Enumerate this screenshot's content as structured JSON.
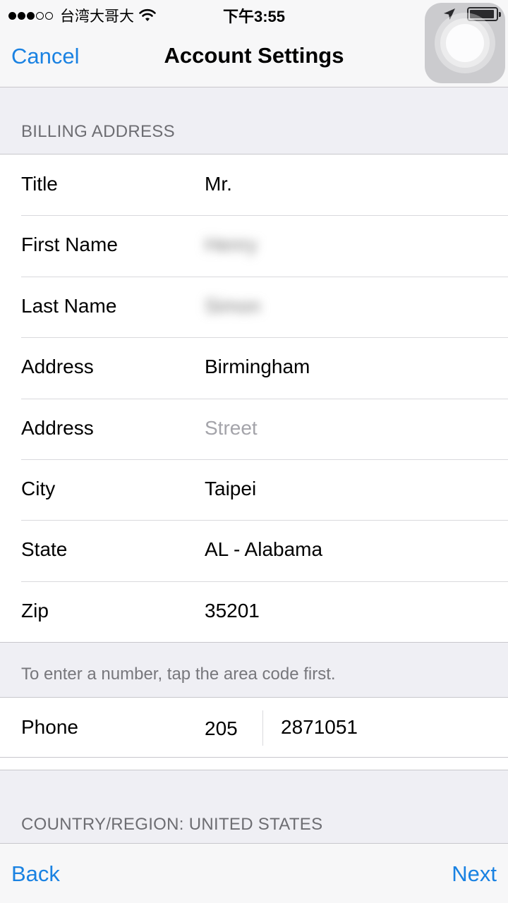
{
  "status_bar": {
    "carrier": "台湾大哥大",
    "time": "下午3:55",
    "signal_icon": "signal-dots-icon",
    "wifi_icon": "wifi-icon",
    "location_icon": "location-arrow-icon",
    "battery_icon": "battery-icon",
    "battery_level": 0.95
  },
  "nav": {
    "cancel_label": "Cancel",
    "title": "Account Settings"
  },
  "billing": {
    "header": "BILLING ADDRESS",
    "rows": [
      {
        "label": "Title",
        "value": "Mr."
      },
      {
        "label": "First Name",
        "value": "Henry"
      },
      {
        "label": "Last Name",
        "value": "Simon"
      },
      {
        "label": "Address",
        "value": "Birmingham"
      },
      {
        "label": "Address",
        "placeholder": "Street"
      },
      {
        "label": "City",
        "value": "Taipei"
      },
      {
        "label": "State",
        "value": "AL - Alabama"
      },
      {
        "label": "Zip",
        "value": "35201"
      }
    ],
    "footer": "To enter a number, tap the area code first."
  },
  "phone": {
    "label": "Phone",
    "area_code": "205",
    "number": "2871051"
  },
  "country": {
    "header": "COUNTRY/REGION: UNITED STATES"
  },
  "bottom": {
    "back_label": "Back",
    "next_label": "Next"
  },
  "colors": {
    "accent": "#1a82e2",
    "background": "#efeff4"
  }
}
